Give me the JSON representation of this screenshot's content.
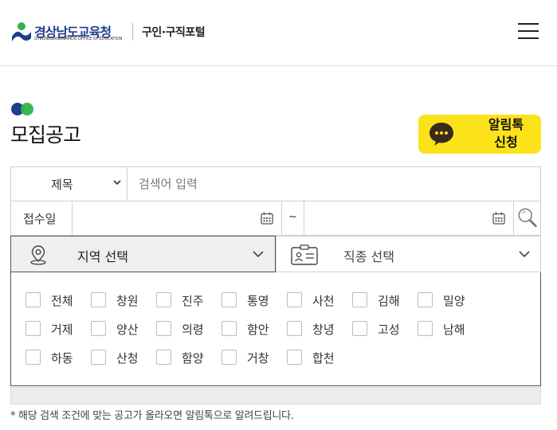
{
  "header": {
    "org_name": "경상남도교육청",
    "org_eng": "GYEONGSANGNAMDO OFFICE OF EDUCATION",
    "portal_name": "구인·구직포털",
    "menu_icon": "hamburger-menu-icon"
  },
  "page": {
    "title": "모집공고",
    "alimtalk_line1": "알림톡",
    "alimtalk_line2": "신청"
  },
  "search": {
    "field_select": "제목",
    "placeholder": "검색어 입력",
    "date_label": "접수일",
    "date_separator": "~",
    "region_select": "지역 선택",
    "job_select": "직종 선택"
  },
  "regions": [
    "전체",
    "창원",
    "진주",
    "통영",
    "사천",
    "김해",
    "밀양",
    "거제",
    "양산",
    "의령",
    "함안",
    "창녕",
    "고성",
    "남해",
    "하동",
    "산청",
    "함양",
    "거창",
    "합천"
  ],
  "notice": "* 해당 검색 조건에 맞는 공고가 올라오면 알림톡으로 알려드립니다.",
  "colors": {
    "brand_blue": "#1d3f8f",
    "accent_green": "#2fb34a",
    "kakao_yellow": "#fce319"
  }
}
